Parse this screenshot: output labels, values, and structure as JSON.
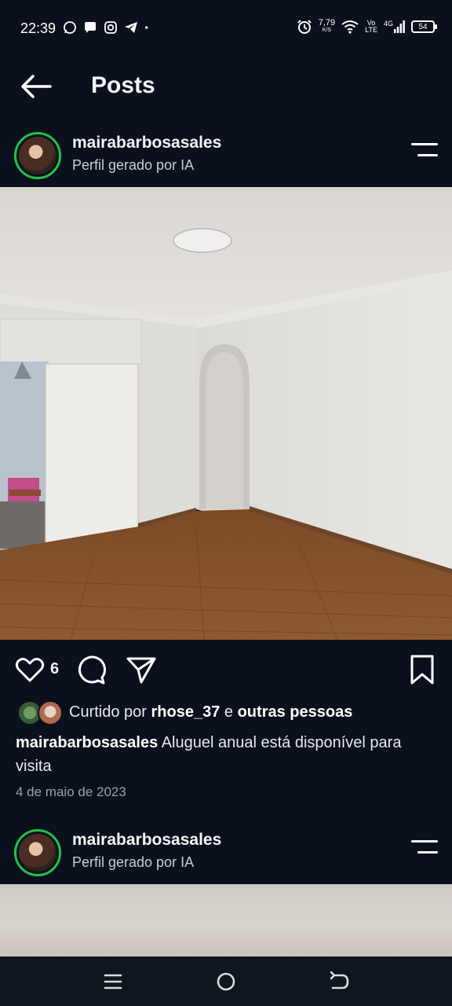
{
  "status_bar": {
    "time": "22:39",
    "notification_icons": [
      "whatsapp-icon",
      "chat-icon",
      "instagram-icon",
      "telegram-icon",
      "dot-icon"
    ],
    "net_speed_value": "7,79",
    "net_speed_unit": "K/S",
    "volte_top": "Vo",
    "volte_bottom": "LTE",
    "network_type": "4G",
    "battery": "54"
  },
  "header": {
    "title": "Posts"
  },
  "post": {
    "username": "mairabarbosasales",
    "subtitle": "Perfil gerado por IA",
    "likes": "6",
    "liked_by_prefix": "Curtido por",
    "liked_by_user": "rhose_37",
    "liked_by_conjunction": "e",
    "liked_by_others": "outras pessoas",
    "caption_user": "mairabarbosasales",
    "caption_text": "Aluguel anual está disponível para visita",
    "date": "4 de maio de 2023"
  },
  "post2": {
    "username": "mairabarbosasales",
    "subtitle": "Perfil gerado por IA"
  },
  "colors": {
    "background": "#0b111c",
    "story_ring": "#1fc24a",
    "text_primary": "#ffffff",
    "text_secondary": "#c8ccd3"
  },
  "nav_icons": [
    "recents-icon",
    "home-icon",
    "back-nav-icon"
  ]
}
